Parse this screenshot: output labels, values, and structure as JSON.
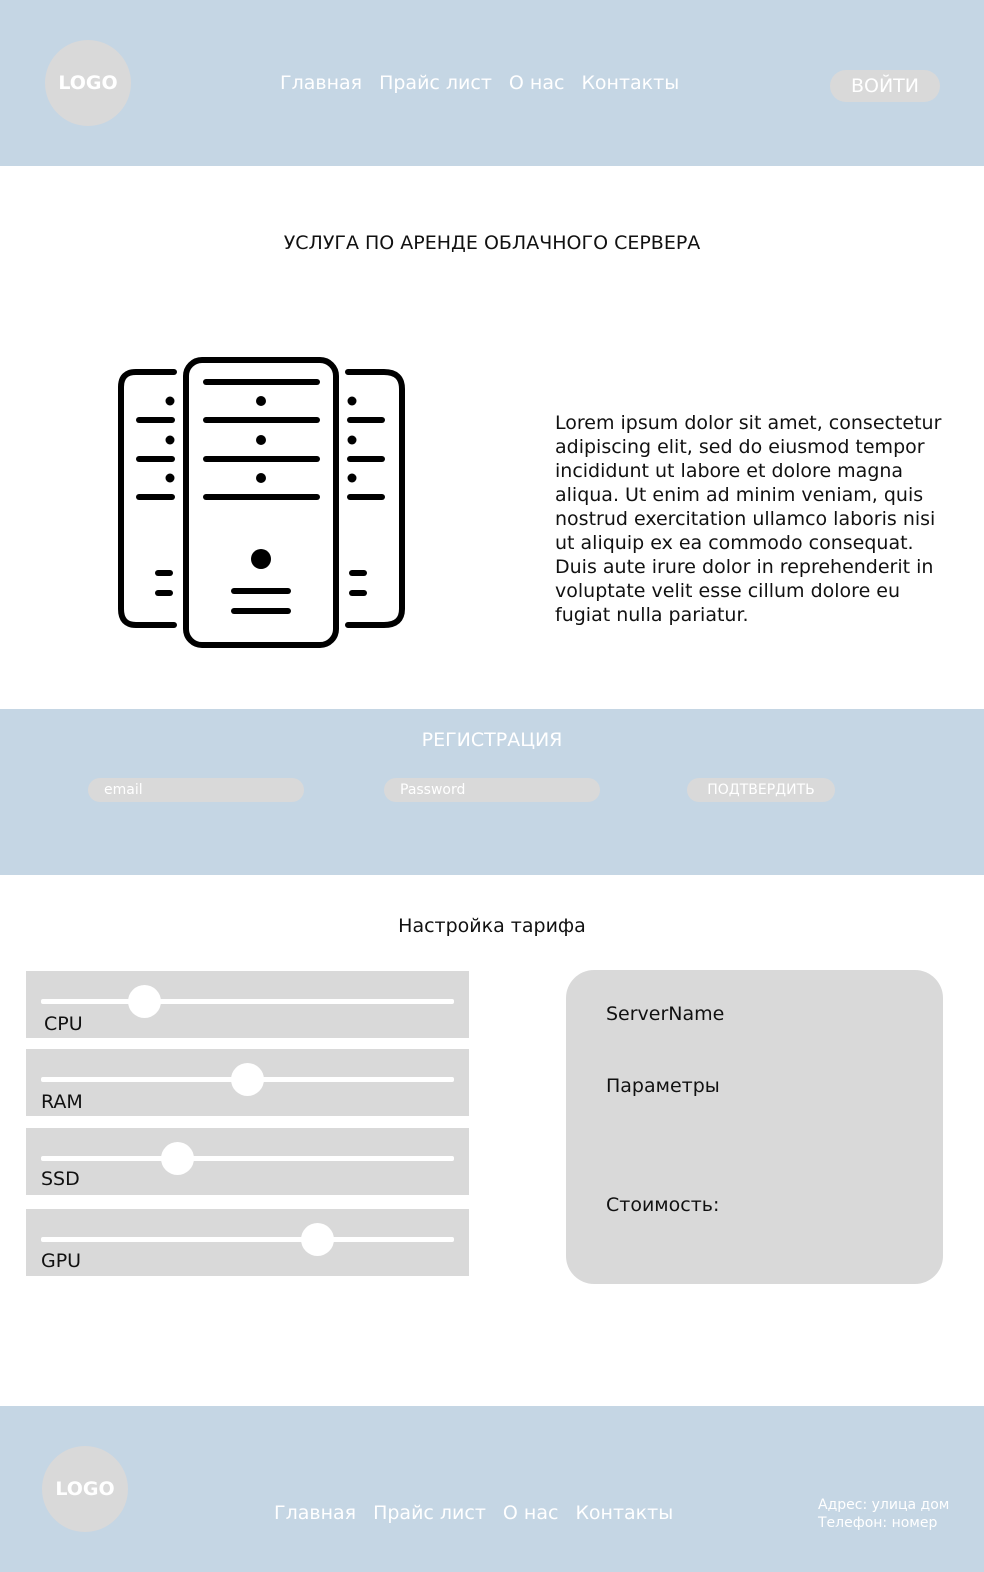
{
  "header": {
    "logo": "LOGO",
    "nav": [
      "Главная",
      "Прайс лист",
      "О нас",
      "Контакты"
    ],
    "login": "ВОЙТИ"
  },
  "hero": {
    "title": "УСЛУГА ПО АРЕНДЕ ОБЛАЧНОГО СЕРВЕРА",
    "icon": "server-rack-icon",
    "text": "Lorem ipsum dolor sit amet, consectetur adipiscing elit, sed do eiusmod tempor incididunt ut labore et dolore magna aliqua. Ut enim ad minim veniam, quis nostrud exercitation ullamco laboris nisi ut aliquip ex ea commodo consequat. Duis aute irure dolor in reprehenderit in voluptate velit esse cillum dolore eu fugiat nulla pariatur."
  },
  "registration": {
    "title": "РЕГИСТРАЦИЯ",
    "email_placeholder": "email",
    "password_placeholder": "Password",
    "confirm": "ПОДТВЕРДИТЬ"
  },
  "tariff": {
    "title": "Настройка тарифа",
    "sliders": [
      {
        "label": "CPU",
        "level": 0.25
      },
      {
        "label": "RAM",
        "level": 0.5
      },
      {
        "label": "SSD",
        "level": 0.33
      },
      {
        "label": "GPU",
        "level": 0.67
      }
    ],
    "summary": {
      "server_name": "ServerName",
      "params": "Параметры",
      "cost": "Стоимость:"
    }
  },
  "footer": {
    "logo": "LOGO",
    "nav": [
      "Главная",
      "Прайс лист",
      "О нас",
      "Контакты"
    ],
    "address": "Адрес: улица дом",
    "phone": "Телефон: номер"
  },
  "colors": {
    "band": "#c5d6e4",
    "control": "#d9d9d9"
  }
}
